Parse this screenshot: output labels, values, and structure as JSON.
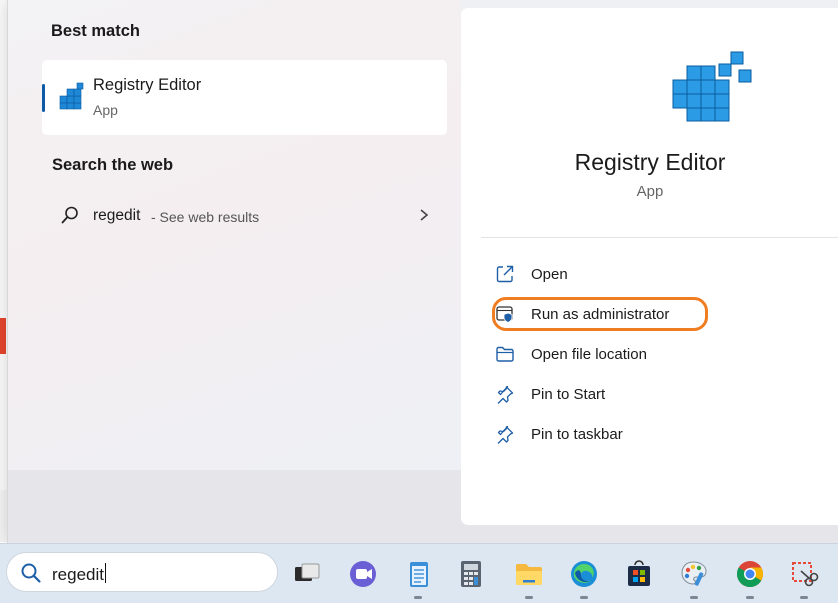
{
  "start_menu": {
    "best_match": {
      "heading": "Best match",
      "app_name": "Registry Editor",
      "app_type": "App",
      "icon": "registry-editor-icon"
    },
    "web": {
      "heading": "Search the web",
      "query": "regedit",
      "suffix": " - See web results",
      "icon": "search-icon"
    }
  },
  "details": {
    "app_name": "Registry Editor",
    "app_type": "App",
    "actions": [
      {
        "label": "Open",
        "icon": "open-external-icon"
      },
      {
        "label": "Run as administrator",
        "icon": "shield-admin-icon",
        "highlighted": true
      },
      {
        "label": "Open file location",
        "icon": "folder-icon"
      },
      {
        "label": "Pin to Start",
        "icon": "pin-icon"
      },
      {
        "label": "Pin to taskbar",
        "icon": "pin-icon"
      }
    ],
    "highlight_color": "#ef7d22"
  },
  "taskbar": {
    "search_value": "regedit",
    "apps": [
      "task-view-icon",
      "teams-icon",
      "notepad-icon",
      "calculator-icon",
      "file-explorer-icon",
      "edge-icon",
      "store-icon",
      "paint-icon",
      "chrome-icon",
      "snipping-tool-icon"
    ]
  },
  "colors": {
    "accent": "#0e5aa7",
    "taskbar": "#dde7f1"
  }
}
